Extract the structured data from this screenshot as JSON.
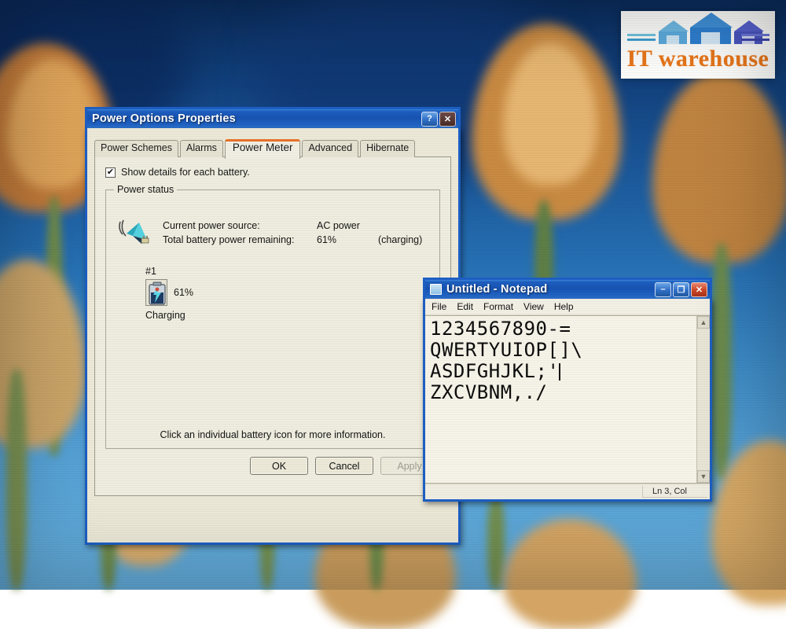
{
  "watermark": {
    "name": "it-warehouse-logo",
    "text_it": "IT",
    "text_warehouse": "warehouse",
    "full_text": "IT warehouse",
    "colors": {
      "word": "#e8761a",
      "house_light": "#5fb4e0",
      "house_mid": "#2f7fd0",
      "house_dark": "#4a55c0",
      "background": "#fdfdfb"
    }
  },
  "power_dialog": {
    "title": "Power Options Properties",
    "help_button": "?",
    "close_button": "✕",
    "tabs": [
      {
        "label": "Power Schemes",
        "active": false
      },
      {
        "label": "Alarms",
        "active": false
      },
      {
        "label": "Power Meter",
        "active": true
      },
      {
        "label": "Advanced",
        "active": false
      },
      {
        "label": "Hibernate",
        "active": false
      }
    ],
    "show_details_checkbox": {
      "label": "Show details for each battery.",
      "checked": true,
      "mark": "✔"
    },
    "power_status": {
      "legend": "Power status",
      "ac_icon_name": "ac-adapter-icon",
      "rows": [
        {
          "label": "Current power source:",
          "value": "AC power",
          "note": ""
        },
        {
          "label": "Total battery power remaining:",
          "value": "61%",
          "note": "(charging)"
        }
      ],
      "battery": {
        "number": "#1",
        "percent": "61%",
        "state": "Charging",
        "icon_name": "battery-charging-icon"
      },
      "hint": "Click an individual battery icon for more information."
    },
    "buttons": [
      {
        "label": "OK",
        "enabled": true
      },
      {
        "label": "Cancel",
        "enabled": true
      },
      {
        "label": "Apply",
        "enabled": false
      }
    ],
    "accent_color": "#e8732a",
    "titlebar_color": "#1d5fc4"
  },
  "notepad": {
    "title": "Untitled - Notepad",
    "minimize_button": "–",
    "maximize_button": "❐",
    "close_button": "✕",
    "menu": [
      "File",
      "Edit",
      "Format",
      "View",
      "Help"
    ],
    "document_lines": [
      "1234567890-=",
      "QWERTYUIOP[]\\",
      "ASDFGHJKL;'",
      "ZXCVBNM,./"
    ],
    "caret_after_line": 3,
    "status_bar": "Ln 3, Col",
    "scroll_up_arrow": "▲",
    "scroll_down_arrow": "▼"
  }
}
